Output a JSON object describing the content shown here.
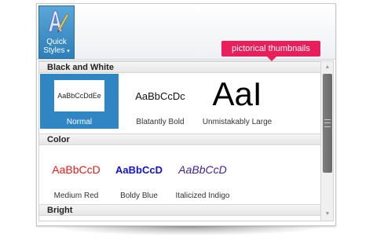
{
  "ribbon": {
    "quick_styles_label": "Quick",
    "quick_styles_label2": "Styles",
    "quick_styles_caret": "▾",
    "icon": "quick-styles-icon"
  },
  "callout": {
    "text": "pictorical thumbnails"
  },
  "gallery": {
    "groups": [
      {
        "name": "Black and White",
        "items": [
          {
            "preview": "AaBbCcDdEe",
            "label": "Normal",
            "selected": true
          },
          {
            "preview": "AaBbCcDc",
            "label": "Blatantly Bold"
          },
          {
            "preview": "AaI",
            "label": "Unmistakably Large"
          }
        ]
      },
      {
        "name": "Color",
        "items": [
          {
            "preview": "AaBbCcD",
            "label": "Medium Red",
            "color": "#e01b1b"
          },
          {
            "preview": "AaBbCcD",
            "label": "Boldy Blue",
            "color": "#1414c8"
          },
          {
            "preview": "AaBbCcD",
            "label": "Italicized Indigo",
            "color": "#3d1f8f"
          }
        ]
      },
      {
        "name": "Bright",
        "items": []
      }
    ]
  },
  "scrollbar": {
    "up_icon": "▲",
    "down_icon": "▼",
    "position": 0.0
  },
  "colors": {
    "accent": "#2f86c2",
    "callout": "#e81f5b"
  }
}
